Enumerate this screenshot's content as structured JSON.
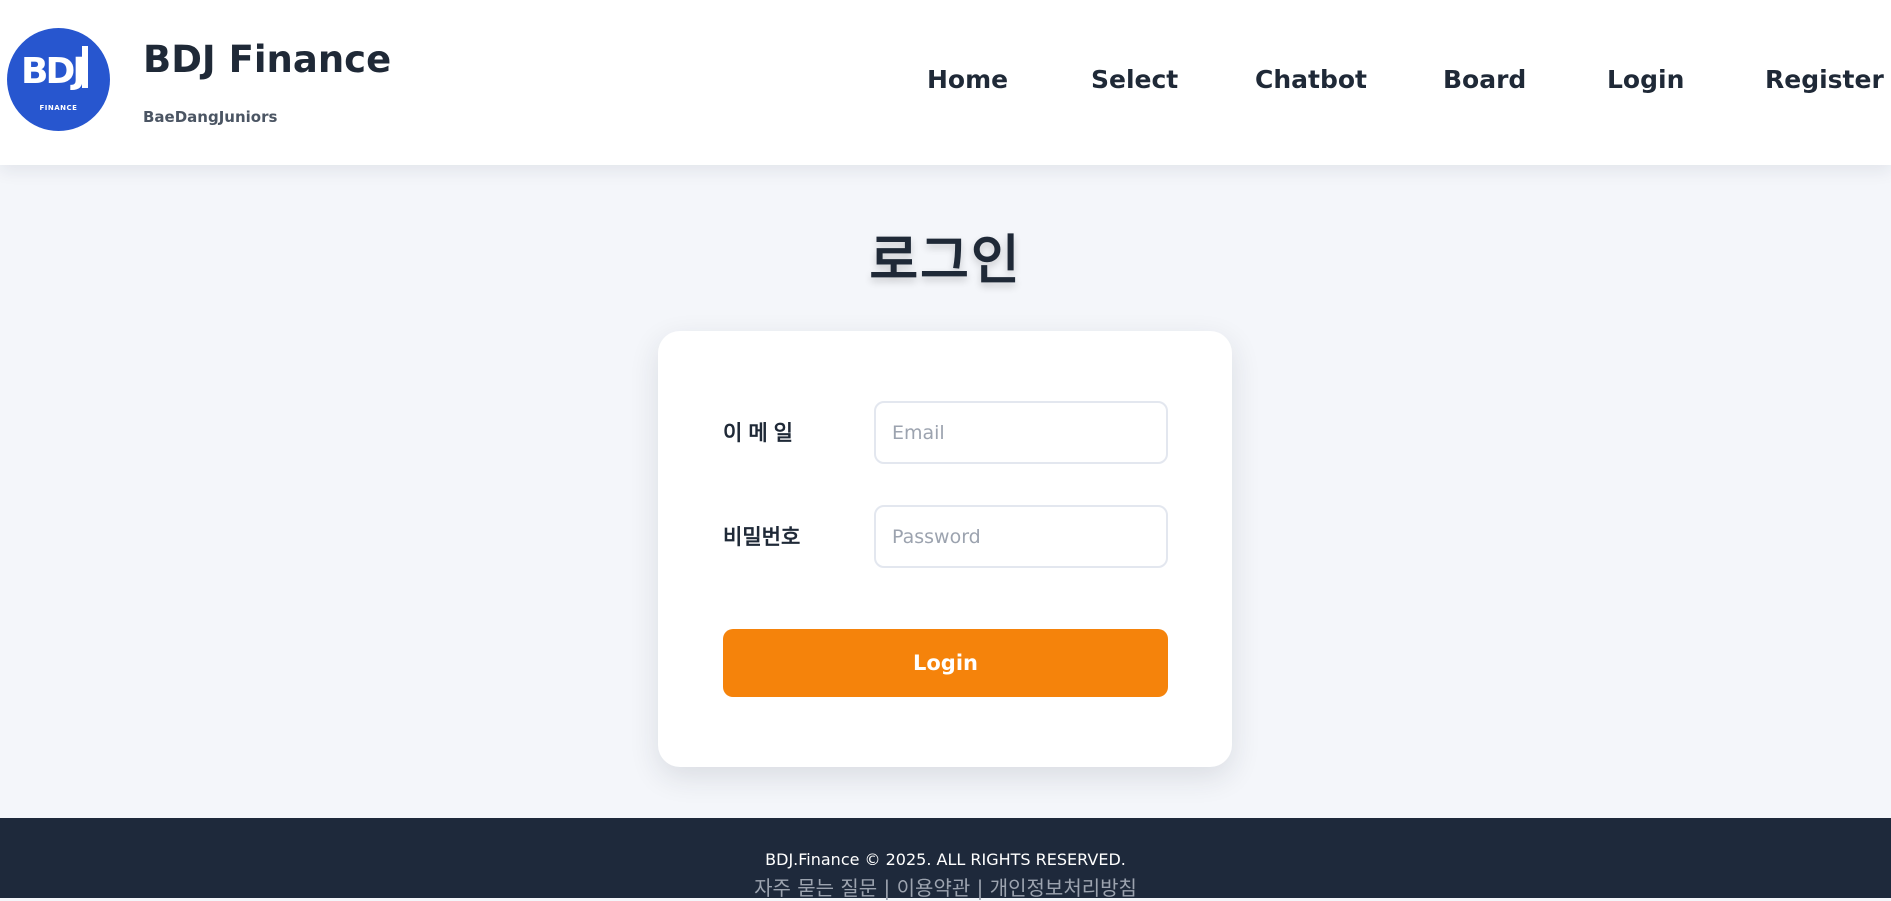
{
  "header": {
    "logo_text": "BDJ",
    "logo_subtext": "FINANCE",
    "brand_title": "BDJ Finance",
    "brand_subtitle": "BaeDangJuniors",
    "nav": [
      {
        "label": "Home"
      },
      {
        "label": "Select"
      },
      {
        "label": "Chatbot"
      },
      {
        "label": "Board"
      },
      {
        "label": "Login"
      },
      {
        "label": "Register"
      }
    ]
  },
  "main": {
    "title": "로그인",
    "form": {
      "email_label": "이메일",
      "email_placeholder": "Email",
      "email_value": "",
      "password_label": "비밀번호",
      "password_placeholder": "Password",
      "password_value": "",
      "submit_label": "Login"
    }
  },
  "footer": {
    "copyright": "BDJ.Finance © 2025. ALL RIGHTS RESERVED.",
    "links": [
      "자주 묻는 질문",
      "이용약관",
      "개인정보처리방침"
    ],
    "separator": " | "
  },
  "colors": {
    "header_bg": "#ffffff",
    "page_bg": "#f4f6fa",
    "brand_blue": "#2756cf",
    "accent_orange": "#f5830b",
    "footer_bg": "#1e293b"
  }
}
